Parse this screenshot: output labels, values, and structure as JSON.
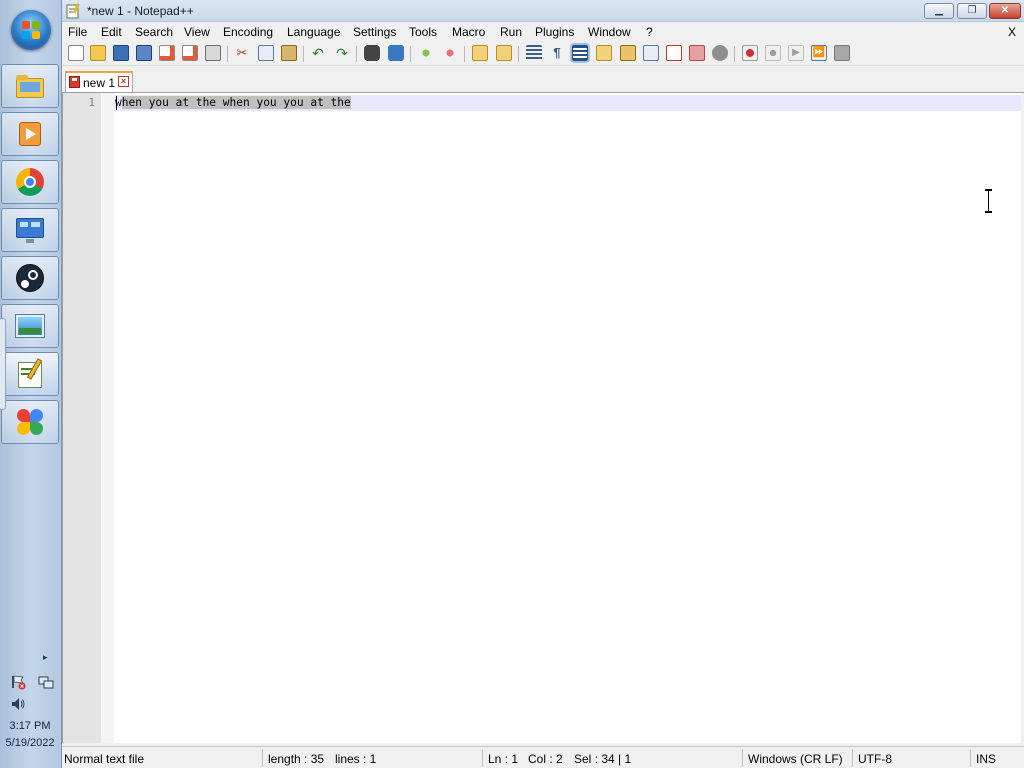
{
  "taskbar": {
    "start_icon": "windows-start-orb",
    "pinned": [
      {
        "name": "file-manager-icon"
      },
      {
        "name": "media-player-icon"
      },
      {
        "name": "chrome-icon"
      },
      {
        "name": "control-panel-icon"
      },
      {
        "name": "steam-icon"
      },
      {
        "name": "image-viewer-icon"
      },
      {
        "name": "notepadpp-icon"
      },
      {
        "name": "pinwheel-app-icon"
      }
    ],
    "tray": {
      "expand_glyph": "▸",
      "clock_time": "3:17 PM",
      "clock_date": "5/19/2022"
    }
  },
  "window": {
    "title": "*new 1 - Notepad++",
    "controls": {
      "minimize": "▁",
      "maximize": "❐",
      "close": "✕"
    }
  },
  "menu": {
    "items": [
      "File",
      "Edit",
      "Search",
      "View",
      "Encoding",
      "Language",
      "Settings",
      "Tools",
      "Macro",
      "Run",
      "Plugins",
      "Window",
      "?"
    ],
    "close_doc": "X"
  },
  "tabs": [
    {
      "label": "new 1",
      "modified": true,
      "active": true
    }
  ],
  "editor": {
    "line_number": "1",
    "text": "when you at the when you you at the",
    "selection": "hen you at the when you you at the"
  },
  "status": {
    "file_type": "Normal text file",
    "length": "length : 35",
    "lines": "lines : 1",
    "ln": "Ln : 1",
    "col": "Col : 2",
    "sel": "Sel : 34 | 1",
    "eol": "Windows (CR LF)",
    "encoding": "UTF-8",
    "mode": "INS"
  },
  "colors": {
    "taskbar": "#c4d6ea",
    "current_line": "#e8e8ff",
    "selection": "#c0c0c0",
    "tab_accent": "#f0a44a"
  }
}
